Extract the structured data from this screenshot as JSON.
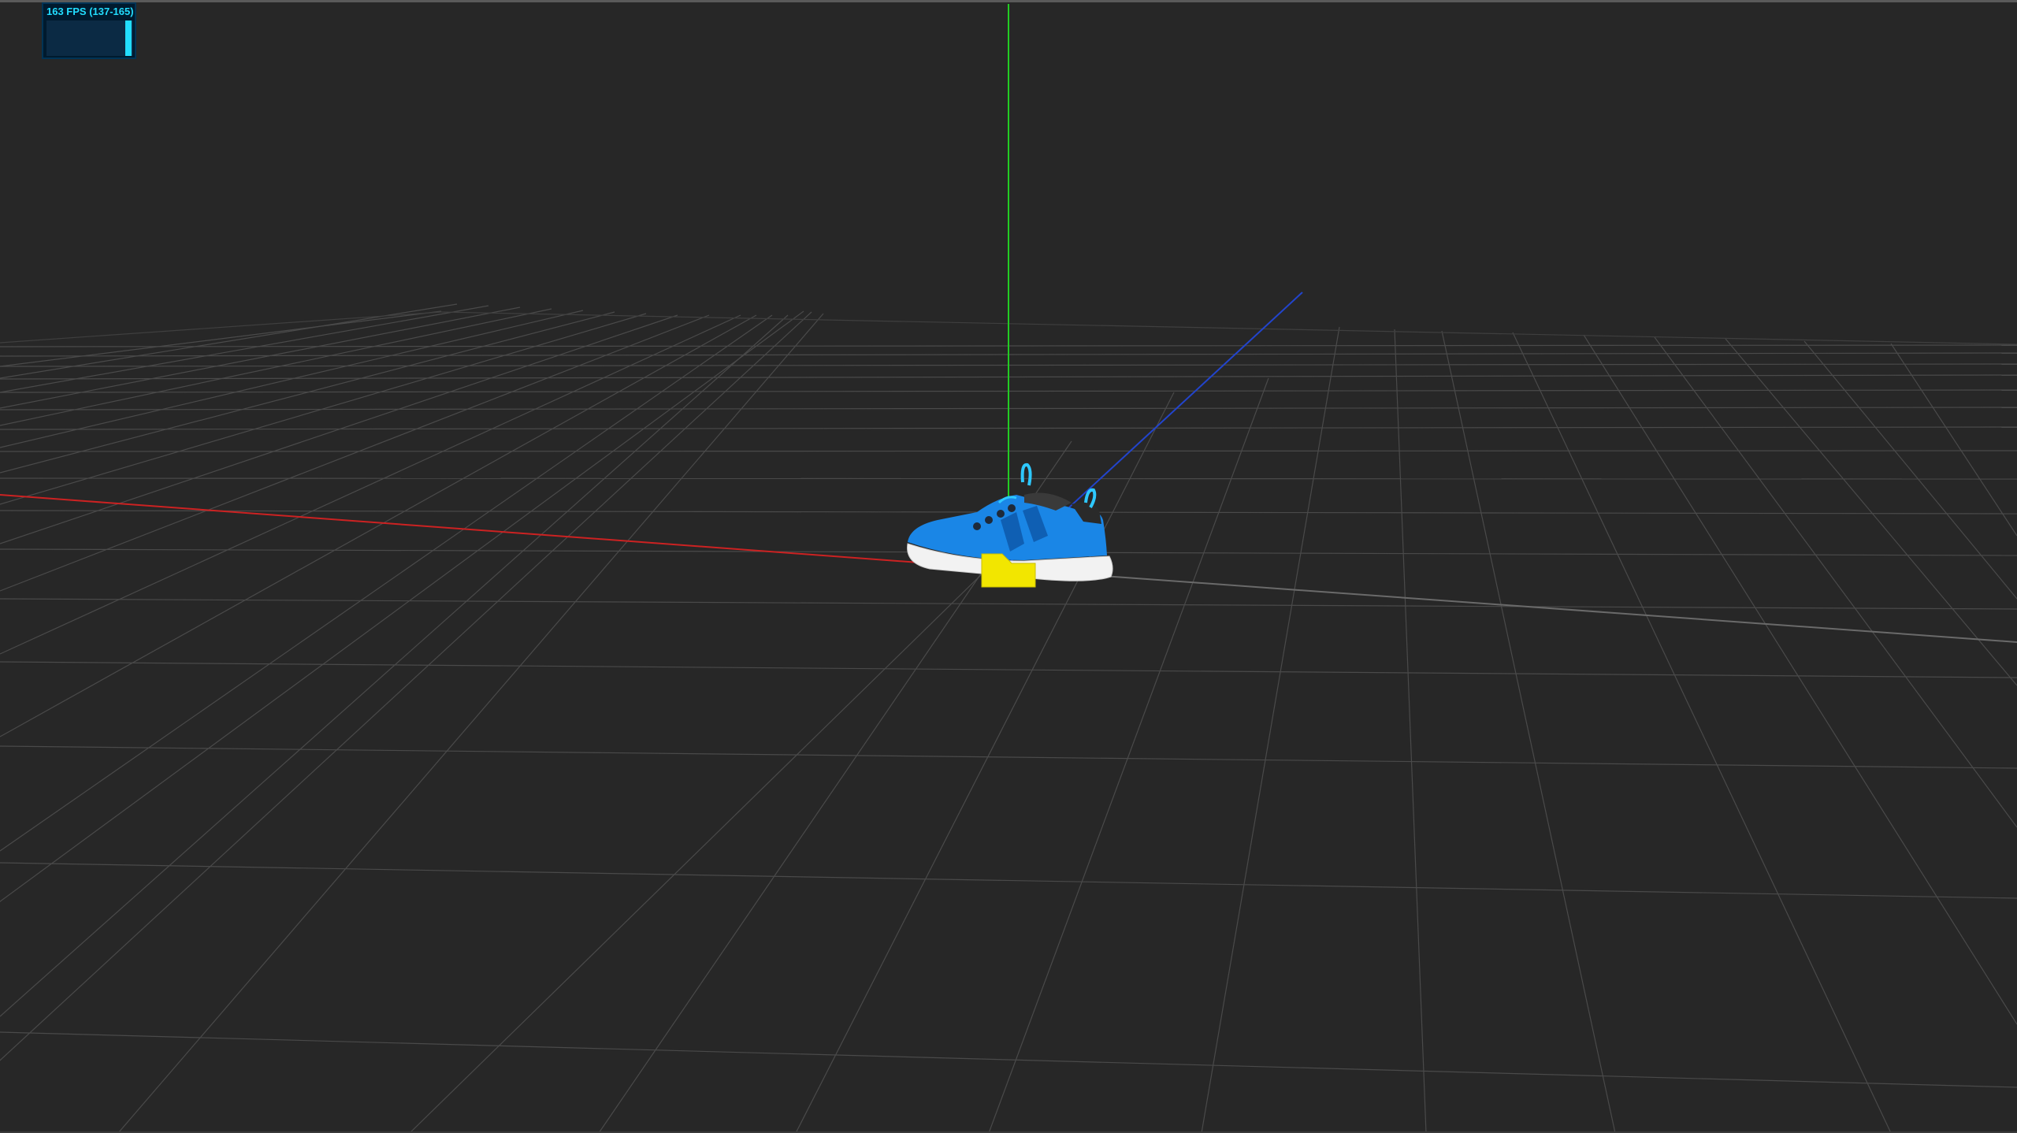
{
  "stats": {
    "fps_text": "163 FPS (137-165)",
    "fps_current": 163,
    "fps_min": 137,
    "fps_max": 165,
    "graph_fill_fraction": 0.99
  },
  "scene": {
    "background_color": "#272727",
    "grid_color": "#4a4a4a",
    "axis_x_color": "#cc2222",
    "axis_y_color": "#22cc22",
    "axis_z_color": "#2244cc",
    "model": "sneaker",
    "model_upper_color": "#1a86e6",
    "model_sole_color": "#f2f2f2",
    "marker_color": "#f2e600"
  }
}
